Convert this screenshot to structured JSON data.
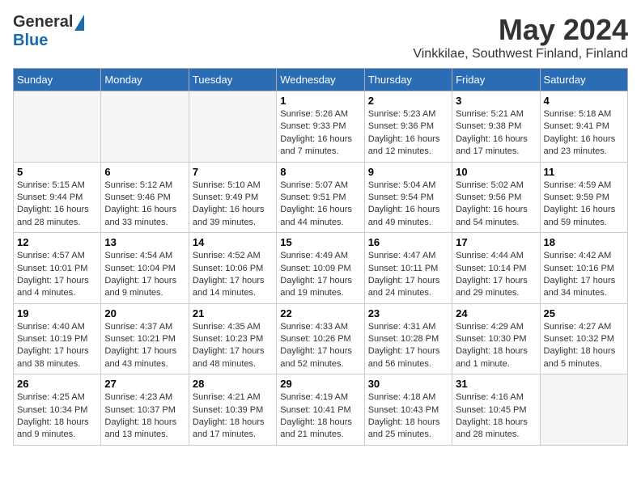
{
  "header": {
    "logo_general": "General",
    "logo_blue": "Blue",
    "month_year": "May 2024",
    "location": "Vinkkilae, Southwest Finland, Finland"
  },
  "weekdays": [
    "Sunday",
    "Monday",
    "Tuesday",
    "Wednesday",
    "Thursday",
    "Friday",
    "Saturday"
  ],
  "weeks": [
    [
      {
        "day": "",
        "empty": true
      },
      {
        "day": "",
        "empty": true
      },
      {
        "day": "",
        "empty": true
      },
      {
        "day": "1",
        "sunrise": "5:26 AM",
        "sunset": "9:33 PM",
        "daylight": "16 hours and 7 minutes."
      },
      {
        "day": "2",
        "sunrise": "5:23 AM",
        "sunset": "9:36 PM",
        "daylight": "16 hours and 12 minutes."
      },
      {
        "day": "3",
        "sunrise": "5:21 AM",
        "sunset": "9:38 PM",
        "daylight": "16 hours and 17 minutes."
      },
      {
        "day": "4",
        "sunrise": "5:18 AM",
        "sunset": "9:41 PM",
        "daylight": "16 hours and 23 minutes."
      }
    ],
    [
      {
        "day": "5",
        "sunrise": "5:15 AM",
        "sunset": "9:44 PM",
        "daylight": "16 hours and 28 minutes."
      },
      {
        "day": "6",
        "sunrise": "5:12 AM",
        "sunset": "9:46 PM",
        "daylight": "16 hours and 33 minutes."
      },
      {
        "day": "7",
        "sunrise": "5:10 AM",
        "sunset": "9:49 PM",
        "daylight": "16 hours and 39 minutes."
      },
      {
        "day": "8",
        "sunrise": "5:07 AM",
        "sunset": "9:51 PM",
        "daylight": "16 hours and 44 minutes."
      },
      {
        "day": "9",
        "sunrise": "5:04 AM",
        "sunset": "9:54 PM",
        "daylight": "16 hours and 49 minutes."
      },
      {
        "day": "10",
        "sunrise": "5:02 AM",
        "sunset": "9:56 PM",
        "daylight": "16 hours and 54 minutes."
      },
      {
        "day": "11",
        "sunrise": "4:59 AM",
        "sunset": "9:59 PM",
        "daylight": "16 hours and 59 minutes."
      }
    ],
    [
      {
        "day": "12",
        "sunrise": "4:57 AM",
        "sunset": "10:01 PM",
        "daylight": "17 hours and 4 minutes."
      },
      {
        "day": "13",
        "sunrise": "4:54 AM",
        "sunset": "10:04 PM",
        "daylight": "17 hours and 9 minutes."
      },
      {
        "day": "14",
        "sunrise": "4:52 AM",
        "sunset": "10:06 PM",
        "daylight": "17 hours and 14 minutes."
      },
      {
        "day": "15",
        "sunrise": "4:49 AM",
        "sunset": "10:09 PM",
        "daylight": "17 hours and 19 minutes."
      },
      {
        "day": "16",
        "sunrise": "4:47 AM",
        "sunset": "10:11 PM",
        "daylight": "17 hours and 24 minutes."
      },
      {
        "day": "17",
        "sunrise": "4:44 AM",
        "sunset": "10:14 PM",
        "daylight": "17 hours and 29 minutes."
      },
      {
        "day": "18",
        "sunrise": "4:42 AM",
        "sunset": "10:16 PM",
        "daylight": "17 hours and 34 minutes."
      }
    ],
    [
      {
        "day": "19",
        "sunrise": "4:40 AM",
        "sunset": "10:19 PM",
        "daylight": "17 hours and 38 minutes."
      },
      {
        "day": "20",
        "sunrise": "4:37 AM",
        "sunset": "10:21 PM",
        "daylight": "17 hours and 43 minutes."
      },
      {
        "day": "21",
        "sunrise": "4:35 AM",
        "sunset": "10:23 PM",
        "daylight": "17 hours and 48 minutes."
      },
      {
        "day": "22",
        "sunrise": "4:33 AM",
        "sunset": "10:26 PM",
        "daylight": "17 hours and 52 minutes."
      },
      {
        "day": "23",
        "sunrise": "4:31 AM",
        "sunset": "10:28 PM",
        "daylight": "17 hours and 56 minutes."
      },
      {
        "day": "24",
        "sunrise": "4:29 AM",
        "sunset": "10:30 PM",
        "daylight": "18 hours and 1 minute."
      },
      {
        "day": "25",
        "sunrise": "4:27 AM",
        "sunset": "10:32 PM",
        "daylight": "18 hours and 5 minutes."
      }
    ],
    [
      {
        "day": "26",
        "sunrise": "4:25 AM",
        "sunset": "10:34 PM",
        "daylight": "18 hours and 9 minutes."
      },
      {
        "day": "27",
        "sunrise": "4:23 AM",
        "sunset": "10:37 PM",
        "daylight": "18 hours and 13 minutes."
      },
      {
        "day": "28",
        "sunrise": "4:21 AM",
        "sunset": "10:39 PM",
        "daylight": "18 hours and 17 minutes."
      },
      {
        "day": "29",
        "sunrise": "4:19 AM",
        "sunset": "10:41 PM",
        "daylight": "18 hours and 21 minutes."
      },
      {
        "day": "30",
        "sunrise": "4:18 AM",
        "sunset": "10:43 PM",
        "daylight": "18 hours and 25 minutes."
      },
      {
        "day": "31",
        "sunrise": "4:16 AM",
        "sunset": "10:45 PM",
        "daylight": "18 hours and 28 minutes."
      },
      {
        "day": "",
        "empty": true
      }
    ]
  ]
}
